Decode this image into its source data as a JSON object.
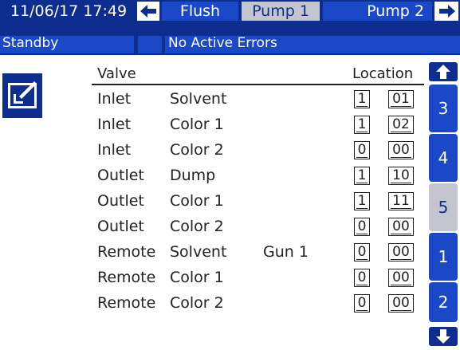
{
  "header": {
    "datetime": "11/06/17 17:49",
    "tabs": [
      {
        "label": "Flush",
        "active": false
      },
      {
        "label": "Pump 1",
        "active": true
      },
      {
        "label": "Pump 2",
        "active": false
      }
    ],
    "left_arrow_icon": "arrow-left-icon",
    "right_arrow_icon": "arrow-right-icon"
  },
  "status": {
    "mode": "Standby",
    "errors": "No Active Errors"
  },
  "edit_icon": "edit-icon",
  "table": {
    "col_valve": "Valve",
    "col_location": "Location",
    "rows": [
      {
        "type": "Inlet",
        "name": "Solvent",
        "extra": "",
        "loc1": "1",
        "loc2": "01"
      },
      {
        "type": "Inlet",
        "name": "Color 1",
        "extra": "",
        "loc1": "1",
        "loc2": "02"
      },
      {
        "type": "Inlet",
        "name": "Color 2",
        "extra": "",
        "loc1": "0",
        "loc2": "00"
      },
      {
        "type": "Outlet",
        "name": "Dump",
        "extra": "",
        "loc1": "1",
        "loc2": "10"
      },
      {
        "type": "Outlet",
        "name": "Color 1",
        "extra": "",
        "loc1": "1",
        "loc2": "11"
      },
      {
        "type": "Outlet",
        "name": "Color 2",
        "extra": "",
        "loc1": "0",
        "loc2": "00"
      },
      {
        "type": "Remote",
        "name": "Solvent",
        "extra": "Gun 1",
        "loc1": "0",
        "loc2": "00"
      },
      {
        "type": "Remote",
        "name": "Color 1",
        "extra": "",
        "loc1": "0",
        "loc2": "00"
      },
      {
        "type": "Remote",
        "name": "Color 2",
        "extra": "",
        "loc1": "0",
        "loc2": "00"
      }
    ]
  },
  "side_nav": {
    "pages": [
      {
        "label": "3",
        "active": false
      },
      {
        "label": "4",
        "active": false
      },
      {
        "label": "5",
        "active": true
      },
      {
        "label": "1",
        "active": false
      },
      {
        "label": "2",
        "active": false
      }
    ],
    "up_icon": "arrow-up-icon",
    "down_icon": "arrow-down-icon"
  },
  "colors": {
    "navy": "#0d2d8f",
    "tab_blue": "#1b48c6",
    "active_gray": "#c3c6cf"
  }
}
